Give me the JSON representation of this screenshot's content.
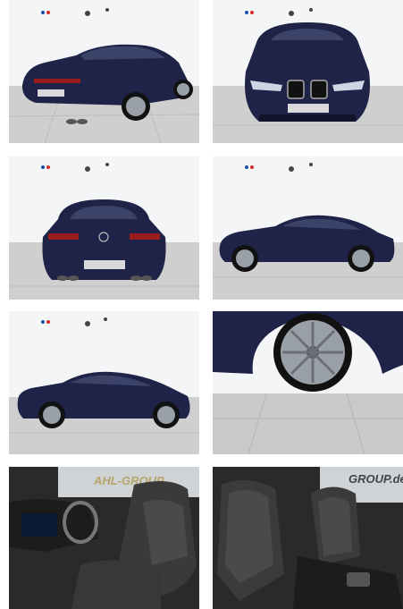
{
  "gallery": {
    "tiles": [
      {
        "name": "photo-rear-three-quarter",
        "alt": "Dark blue coupe, rear three-quarter view"
      },
      {
        "name": "photo-front-view",
        "alt": "Dark blue sedan, front view"
      },
      {
        "name": "photo-rear-view",
        "alt": "Dark blue coupe, rear view"
      },
      {
        "name": "photo-side-view-left",
        "alt": "Dark blue coupe, side view"
      },
      {
        "name": "photo-side-view-right",
        "alt": "Dark blue coupe, side view"
      },
      {
        "name": "photo-wheel-closeup",
        "alt": "Alloy wheel close-up"
      },
      {
        "name": "photo-interior-driver",
        "alt": "Interior, driver seat and dashboard"
      },
      {
        "name": "photo-interior-seats",
        "alt": "Interior, front seats"
      }
    ]
  },
  "colors": {
    "paint": "#1e2347",
    "paint_dark": "#10132a",
    "wall": "#f4f5f6",
    "floor": "#c9c9c9",
    "interior": "#2a2a2a"
  },
  "banners": {
    "driver_photo_text": "AHL-GROUP",
    "seats_photo_text": "GROUP.de"
  },
  "wall_logos": {
    "m_mark": "M"
  }
}
